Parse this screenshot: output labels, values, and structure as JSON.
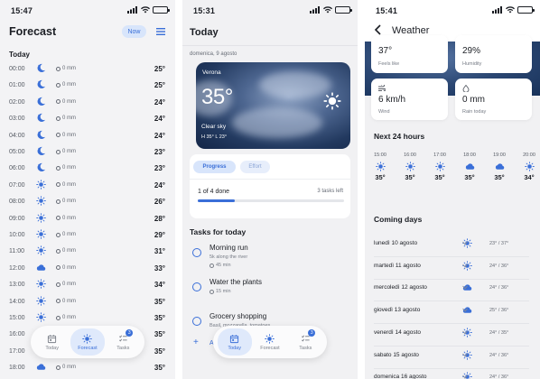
{
  "colors": {
    "accent": "#3a6fd8",
    "sun": "#3a6fd8",
    "card": "#ffffff",
    "bg": "#f3f3f5"
  },
  "screen1": {
    "status_time": "15:47",
    "title": "Forecast",
    "now_button": "Now",
    "section_label": "Today",
    "hours": [
      {
        "time": "00:00",
        "icon": "moon-icon",
        "rain": "0 mm",
        "temp": "25°"
      },
      {
        "time": "01:00",
        "icon": "moon-icon",
        "rain": "0 mm",
        "temp": "25°"
      },
      {
        "time": "02:00",
        "icon": "moon-icon",
        "rain": "0 mm",
        "temp": "24°"
      },
      {
        "time": "03:00",
        "icon": "moon-icon",
        "rain": "0 mm",
        "temp": "24°"
      },
      {
        "time": "04:00",
        "icon": "moon-icon",
        "rain": "0 mm",
        "temp": "24°"
      },
      {
        "time": "05:00",
        "icon": "moon-icon",
        "rain": "0 mm",
        "temp": "23°"
      },
      {
        "time": "06:00",
        "icon": "moon-icon",
        "rain": "0 mm",
        "temp": "23°"
      },
      {
        "time": "07:00",
        "icon": "sun-icon",
        "rain": "0 mm",
        "temp": "24°"
      },
      {
        "time": "08:00",
        "icon": "sun-icon",
        "rain": "0 mm",
        "temp": "26°"
      },
      {
        "time": "09:00",
        "icon": "sun-icon",
        "rain": "0 mm",
        "temp": "28°"
      },
      {
        "time": "10:00",
        "icon": "sun-icon",
        "rain": "0 mm",
        "temp": "29°"
      },
      {
        "time": "11:00",
        "icon": "sun-icon",
        "rain": "0 mm",
        "temp": "31°"
      },
      {
        "time": "12:00",
        "icon": "cloud-icon",
        "rain": "0 mm",
        "temp": "33°"
      },
      {
        "time": "13:00",
        "icon": "sun-icon",
        "rain": "0 mm",
        "temp": "34°"
      },
      {
        "time": "14:00",
        "icon": "sun-icon",
        "rain": "0 mm",
        "temp": "35°"
      },
      {
        "time": "15:00",
        "icon": "sun-icon",
        "rain": "0 mm",
        "temp": "35°"
      },
      {
        "time": "16:00",
        "icon": "sun-icon",
        "rain": "0 mm",
        "temp": "35°"
      },
      {
        "time": "17:00",
        "icon": "sun-icon",
        "rain": "0 mm",
        "temp": "35°"
      },
      {
        "time": "18:00",
        "icon": "cloud-icon",
        "rain": "0 mm",
        "temp": "35°"
      }
    ],
    "tabs": [
      {
        "label": "Today",
        "icon": "calendar-icon",
        "active": false
      },
      {
        "label": "Forecast",
        "icon": "sun-icon",
        "active": true
      },
      {
        "label": "Tasks",
        "icon": "checklist-icon",
        "active": false,
        "badge": "3"
      }
    ]
  },
  "screen2": {
    "status_time": "15:31",
    "title": "Today",
    "date": "domenica, 9 agosto",
    "hero": {
      "city": "Verona",
      "temp": "35°",
      "condition": "Clear sky",
      "hilo": "H 35°  L 23°"
    },
    "chips": [
      "Progress",
      "Effort"
    ],
    "progress": {
      "done_text": "1 of 4 done",
      "left_text": "3 tasks left",
      "fraction": 0.25
    },
    "tasks_title": "Tasks for today",
    "tasks": [
      {
        "title": "Morning run",
        "subtitle": "5k along the river",
        "duration": "45 min"
      },
      {
        "title": "Water the plants",
        "subtitle": "",
        "duration": "15 min"
      },
      {
        "title": "Grocery shopping",
        "subtitle": "Basil, mozzarella, tomatoes",
        "duration": ""
      }
    ],
    "add_task": "A",
    "tabs": [
      {
        "label": "Today",
        "icon": "calendar-icon",
        "active": true
      },
      {
        "label": "Forecast",
        "icon": "sun-icon",
        "active": false
      },
      {
        "label": "Tasks",
        "icon": "checklist-icon",
        "active": false,
        "badge": "3"
      }
    ]
  },
  "screen3": {
    "status_time": "15:41",
    "title": "Weather",
    "stats": [
      {
        "value": "37°",
        "label": "Feels like"
      },
      {
        "value": "29%",
        "label": "Humidity"
      },
      {
        "value": "6 km/h",
        "label": "Wind",
        "icon": "wind-icon"
      },
      {
        "value": "0 mm",
        "label": "Rain today",
        "icon": "drop-icon"
      }
    ],
    "next24_title": "Next 24 hours",
    "next24": [
      {
        "time": "15:00",
        "icon": "sun-icon",
        "temp": "35°"
      },
      {
        "time": "16:00",
        "icon": "sun-icon",
        "temp": "35°"
      },
      {
        "time": "17:00",
        "icon": "sun-icon",
        "temp": "35°"
      },
      {
        "time": "18:00",
        "icon": "cloud-icon",
        "temp": "35°"
      },
      {
        "time": "19:00",
        "icon": "cloud-icon",
        "temp": "35°"
      },
      {
        "time": "20:00",
        "icon": "sun-icon",
        "temp": "34°"
      }
    ],
    "coming_title": "Coming days",
    "days": [
      {
        "name": "lunedì 10 agosto",
        "icon": "sun-icon",
        "range": "23° / 37°"
      },
      {
        "name": "martedì 11 agosto",
        "icon": "sun-icon",
        "range": "24° / 36°"
      },
      {
        "name": "mercoledì 12 agosto",
        "icon": "cloud-icon",
        "range": "24° / 36°"
      },
      {
        "name": "giovedì 13 agosto",
        "icon": "cloud-icon",
        "range": "25° / 36°"
      },
      {
        "name": "venerdì 14 agosto",
        "icon": "sun-icon",
        "range": "24° / 35°"
      },
      {
        "name": "sabato 15 agosto",
        "icon": "sun-icon",
        "range": "24° / 36°"
      },
      {
        "name": "domenica 16 agosto",
        "icon": "sun-icon",
        "range": "24° / 36°"
      }
    ]
  }
}
